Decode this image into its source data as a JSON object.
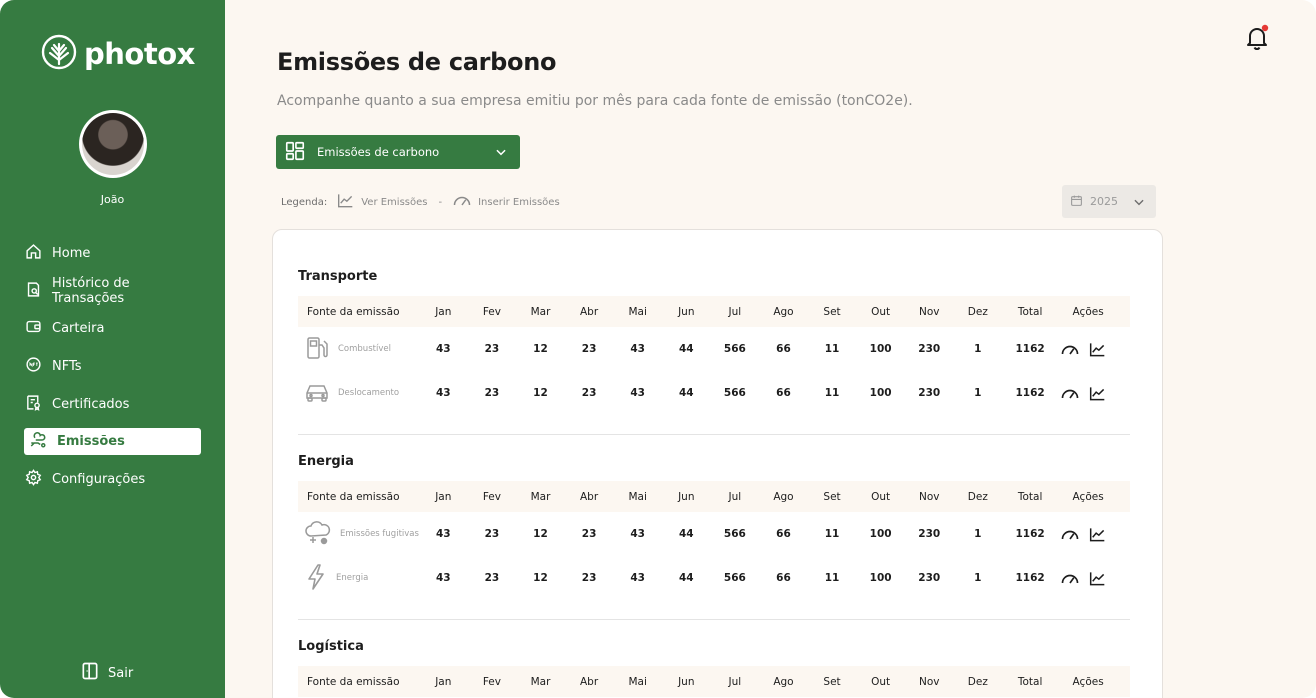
{
  "app": {
    "brand": "photox"
  },
  "user": {
    "name": "João"
  },
  "sidebar": {
    "items": [
      {
        "label": "Home",
        "icon": "home-icon"
      },
      {
        "label": "Histórico de Transações",
        "icon": "history-icon"
      },
      {
        "label": "Carteira",
        "icon": "wallet-icon"
      },
      {
        "label": "NFTs",
        "icon": "nft-icon"
      },
      {
        "label": "Certificados",
        "icon": "certificate-icon"
      },
      {
        "label": "Emissões",
        "icon": "emissions-icon",
        "active": true
      },
      {
        "label": "Configurações",
        "icon": "gear-icon"
      }
    ],
    "logout_label": "Sair"
  },
  "header": {
    "title": "Emissões de carbono",
    "subtitle": "Acompanhe quanto a sua empresa emitiu por mês para cada fonte de emissão (tonCO2e)."
  },
  "selector": {
    "value": "Emissões de carbono"
  },
  "legend": {
    "label": "Legenda:",
    "view_label": "Ver Emissões",
    "separator": "-",
    "insert_label": "Inserir Emissões"
  },
  "year_filter": {
    "value": "2025"
  },
  "table": {
    "columns": [
      "Fonte da emissão",
      "Jan",
      "Fev",
      "Mar",
      "Abr",
      "Mai",
      "Jun",
      "Jul",
      "Ago",
      "Set",
      "Out",
      "Nov",
      "Dez",
      "Total",
      "Ações"
    ],
    "sections": [
      {
        "title": "Transporte",
        "rows": [
          {
            "source": "Combustível",
            "icon": "fuel-pump-icon",
            "values": [
              "43",
              "23",
              "12",
              "23",
              "43",
              "44",
              "566",
              "66",
              "11",
              "100",
              "230",
              "1"
            ],
            "total": "1162"
          },
          {
            "source": "Deslocamento",
            "icon": "car-icon",
            "values": [
              "43",
              "23",
              "12",
              "23",
              "43",
              "44",
              "566",
              "66",
              "11",
              "100",
              "230",
              "1"
            ],
            "total": "1162"
          }
        ]
      },
      {
        "title": "Energia",
        "rows": [
          {
            "source": "Emissões fugitivas",
            "icon": "cloud-icon",
            "values": [
              "43",
              "23",
              "12",
              "23",
              "43",
              "44",
              "566",
              "66",
              "11",
              "100",
              "230",
              "1"
            ],
            "total": "1162"
          },
          {
            "source": "Energia",
            "icon": "lightning-icon",
            "values": [
              "43",
              "23",
              "12",
              "23",
              "43",
              "44",
              "566",
              "66",
              "11",
              "100",
              "230",
              "1"
            ],
            "total": "1162"
          }
        ]
      },
      {
        "title": "Logística",
        "rows": []
      }
    ]
  },
  "colors": {
    "brand_green": "#367b41",
    "background": "#fcf7f1",
    "notification_dot": "#e53935"
  }
}
